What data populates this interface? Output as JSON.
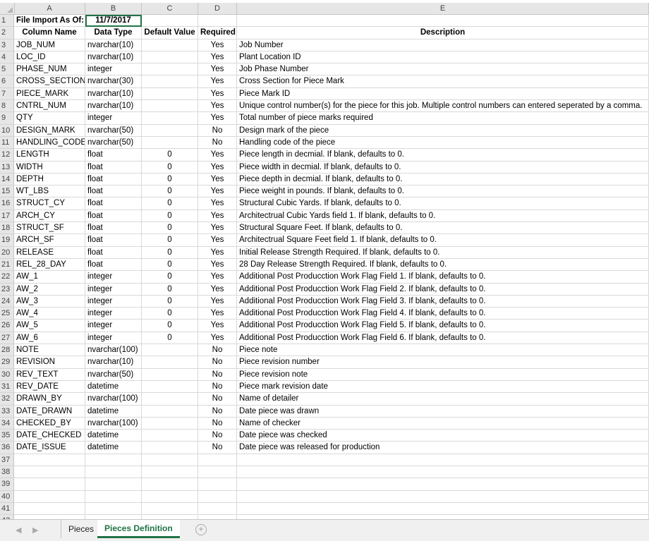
{
  "columns": [
    "A",
    "B",
    "C",
    "D",
    "E"
  ],
  "row1": {
    "label": "File Import As Of:",
    "date": "11/7/2017"
  },
  "headers": {
    "a": "Column Name",
    "b": "Data Type",
    "c": "Default Value",
    "d": "Required",
    "e": "Description"
  },
  "rows": [
    {
      "a": "JOB_NUM",
      "b": "nvarchar(10)",
      "c": "",
      "d": "Yes",
      "e": "Job Number"
    },
    {
      "a": "LOC_ID",
      "b": "nvarchar(10)",
      "c": "",
      "d": "Yes",
      "e": "Plant Location ID"
    },
    {
      "a": "PHASE_NUM",
      "b": "integer",
      "c": "",
      "d": "Yes",
      "e": "Job Phase Number"
    },
    {
      "a": "CROSS_SECTION",
      "b": "nvarchar(30)",
      "c": "",
      "d": "Yes",
      "e": "Cross Section for Piece Mark"
    },
    {
      "a": "PIECE_MARK",
      "b": "nvarchar(10)",
      "c": "",
      "d": "Yes",
      "e": "Piece Mark ID"
    },
    {
      "a": "CNTRL_NUM",
      "b": "nvarchar(10)",
      "c": "",
      "d": "Yes",
      "e": "Unique control number(s) for the piece for this job.  Multiple control numbers can entered seperated by a comma."
    },
    {
      "a": "QTY",
      "b": "integer",
      "c": "",
      "d": "Yes",
      "e": "Total number of piece marks required"
    },
    {
      "a": "DESIGN_MARK",
      "b": "nvarchar(50)",
      "c": "",
      "d": "No",
      "e": "Design mark of the piece"
    },
    {
      "a": "HANDLING_CODE",
      "b": "nvarchar(50)",
      "c": "",
      "d": "No",
      "e": "Handling code of the piece"
    },
    {
      "a": "LENGTH",
      "b": "float",
      "c": "0",
      "d": "Yes",
      "e": "Piece length in decmial. If blank, defaults to 0."
    },
    {
      "a": "WIDTH",
      "b": "float",
      "c": "0",
      "d": "Yes",
      "e": "Piece width in decmial. If blank, defaults to 0."
    },
    {
      "a": "DEPTH",
      "b": "float",
      "c": "0",
      "d": "Yes",
      "e": "Piece depth in decmial. If blank, defaults to 0."
    },
    {
      "a": "WT_LBS",
      "b": "float",
      "c": "0",
      "d": "Yes",
      "e": "Piece weight in pounds. If blank, defaults to 0."
    },
    {
      "a": "STRUCT_CY",
      "b": "float",
      "c": "0",
      "d": "Yes",
      "e": "Structural Cubic Yards. If blank, defaults to 0."
    },
    {
      "a": "ARCH_CY",
      "b": "float",
      "c": "0",
      "d": "Yes",
      "e": "Architectrual Cubic Yards field 1. If blank, defaults to 0."
    },
    {
      "a": "STRUCT_SF",
      "b": "float",
      "c": "0",
      "d": "Yes",
      "e": "Structural Square Feet. If blank, defaults to 0."
    },
    {
      "a": "ARCH_SF",
      "b": "float",
      "c": "0",
      "d": "Yes",
      "e": "Architectrual Square Feet field 1. If blank, defaults to 0."
    },
    {
      "a": "RELEASE",
      "b": "float",
      "c": "0",
      "d": "Yes",
      "e": "Initial Release Strength Required. If blank, defaults to 0."
    },
    {
      "a": "REL_28_DAY",
      "b": "float",
      "c": "0",
      "d": "Yes",
      "e": "28 Day Release Strength Required. If blank, defaults to 0."
    },
    {
      "a": "AW_1",
      "b": "integer",
      "c": "0",
      "d": "Yes",
      "e": "Additional Post Producction Work Flag Field 1. If blank, defaults to 0."
    },
    {
      "a": "AW_2",
      "b": "integer",
      "c": "0",
      "d": "Yes",
      "e": "Additional Post Producction Work Flag Field 2. If blank, defaults to 0."
    },
    {
      "a": "AW_3",
      "b": "integer",
      "c": "0",
      "d": "Yes",
      "e": "Additional Post Producction Work Flag Field 3. If blank, defaults to 0."
    },
    {
      "a": "AW_4",
      "b": "integer",
      "c": "0",
      "d": "Yes",
      "e": "Additional Post Producction Work Flag Field 4. If blank, defaults to 0."
    },
    {
      "a": "AW_5",
      "b": "integer",
      "c": "0",
      "d": "Yes",
      "e": "Additional Post Producction Work Flag Field 5. If blank, defaults to 0."
    },
    {
      "a": "AW_6",
      "b": "integer",
      "c": "0",
      "d": "Yes",
      "e": "Additional Post Producction Work Flag Field 6. If blank, defaults to 0."
    },
    {
      "a": "NOTE",
      "b": "nvarchar(100)",
      "c": "",
      "d": "No",
      "e": "Piece note"
    },
    {
      "a": "REVISION",
      "b": "nvarchar(10)",
      "c": "",
      "d": "No",
      "e": "Piece revision number"
    },
    {
      "a": "REV_TEXT",
      "b": "nvarchar(50)",
      "c": "",
      "d": "No",
      "e": "Piece revision note"
    },
    {
      "a": "REV_DATE",
      "b": "datetime",
      "c": "",
      "d": "No",
      "e": "Piece mark revision date"
    },
    {
      "a": "DRAWN_BY",
      "b": "nvarchar(100)",
      "c": "",
      "d": "No",
      "e": "Name of detailer"
    },
    {
      "a": "DATE_DRAWN",
      "b": "datetime",
      "c": "",
      "d": "No",
      "e": "Date piece was drawn"
    },
    {
      "a": "CHECKED_BY",
      "b": "nvarchar(100)",
      "c": "",
      "d": "No",
      "e": "Name of checker"
    },
    {
      "a": "DATE_CHECKED",
      "b": "datetime",
      "c": "",
      "d": "No",
      "e": "Date piece was checked"
    },
    {
      "a": "DATE_ISSUE",
      "b": "datetime",
      "c": "",
      "d": "No",
      "e": "Date piece was released for production"
    }
  ],
  "empty_row_count": 6,
  "tabs": {
    "prev_icon": "◀",
    "next_icon": "▶",
    "items": [
      "Pieces",
      "Pieces Definition"
    ],
    "active": "Pieces Definition",
    "add_icon": "+"
  },
  "colors": {
    "accent": "#217346",
    "header_bg": "#e6e6e6"
  }
}
